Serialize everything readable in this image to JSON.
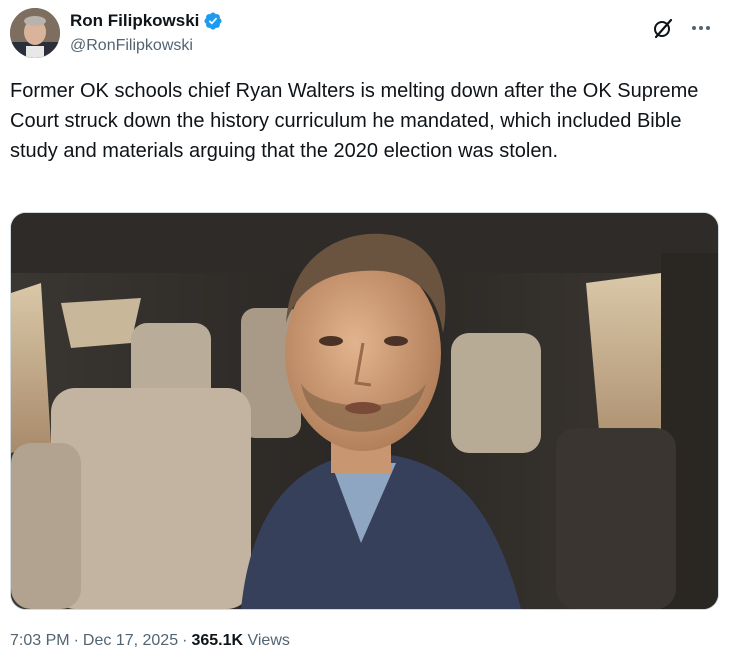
{
  "author": {
    "display_name": "Ron Filipkowski",
    "handle": "@RonFilipkowski",
    "verified": true
  },
  "actions": {
    "grok_icon": "grok-icon",
    "more_icon": "more-icon"
  },
  "post": {
    "text": "Former OK schools chief Ryan Walters is melting down after the OK Supreme Court struck down the history curriculum he mandated, which included Bible study and materials arguing that the 2020 election was stolen."
  },
  "meta": {
    "time": "7:03 PM",
    "date": "Dec 17, 2025",
    "views_count": "365.1K",
    "views_label": "Views",
    "separator": "·"
  },
  "colors": {
    "verified_blue": "#1d9bf0",
    "secondary_text": "#536471",
    "primary_text": "#0f1419"
  }
}
